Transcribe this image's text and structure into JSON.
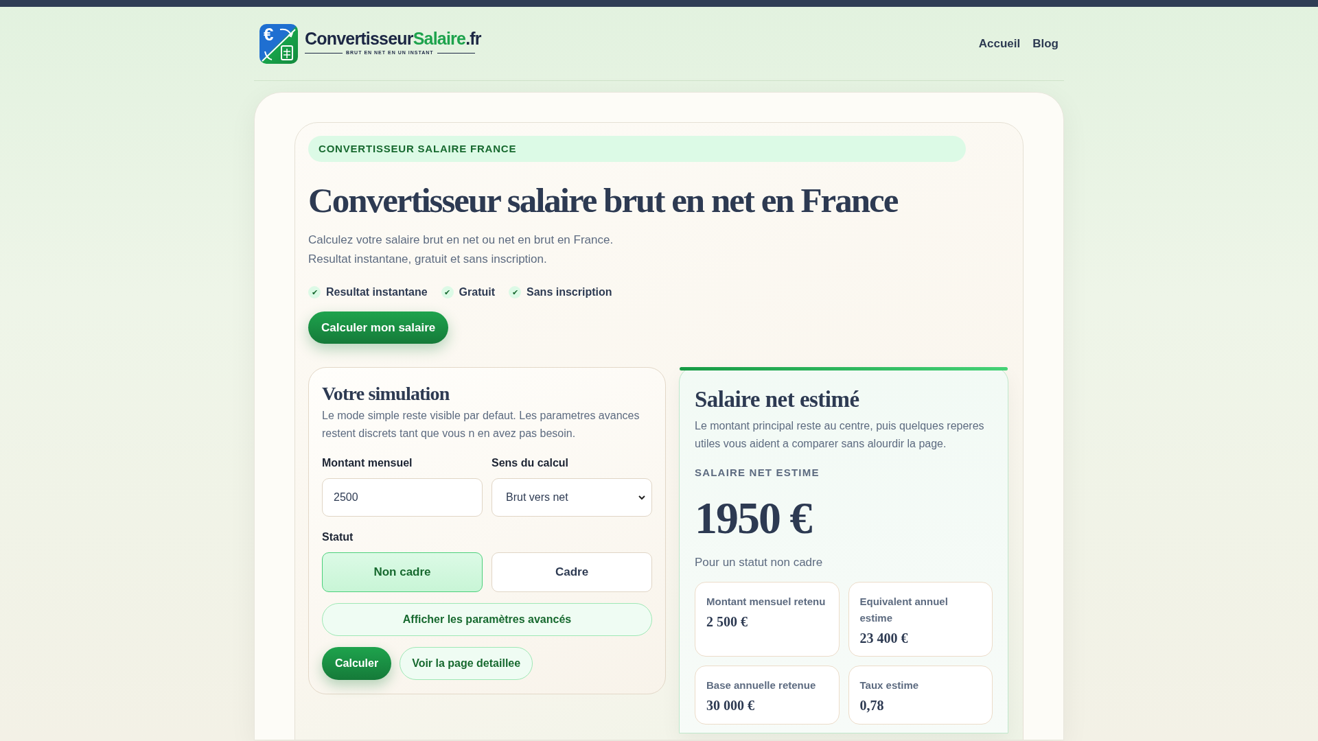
{
  "logo": {
    "icon_glyph": "€",
    "title_main": "Convertisseur",
    "title_accent": "Salaire",
    "title_suffix": ".fr",
    "tagline": "BRUT EN NET EN UN INSTANT"
  },
  "nav": [
    {
      "label": "Accueil"
    },
    {
      "label": "Blog"
    }
  ],
  "hero": {
    "badge": "CONVERTISSEUR SALAIRE FRANCE",
    "title": "Convertisseur salaire brut en net en France",
    "lines": [
      "Calculez votre salaire brut en net ou net en brut en France.",
      "Resultat instantane, gratuit et sans inscription."
    ],
    "features": [
      {
        "mark": "✔",
        "label": "Resultat instantane"
      },
      {
        "mark": "✔",
        "label": "Gratuit"
      },
      {
        "mark": "✔",
        "label": "Sans inscription"
      }
    ],
    "cta": "Calculer mon salaire"
  },
  "simulation": {
    "title": "Votre simulation",
    "description": "Le mode simple reste visible par defaut. Les parametres avances restent discrets tant que vous n en avez pas besoin.",
    "amount": {
      "label": "Montant mensuel",
      "value": "2500"
    },
    "direction": {
      "label": "Sens du calcul",
      "value": "Brut vers net"
    },
    "status_label": "Statut",
    "status_options": [
      {
        "label": "Non cadre",
        "selected": true
      },
      {
        "label": "Cadre",
        "selected": false
      }
    ],
    "advanced_button": "Afficher les paramètres avancés",
    "actions": [
      {
        "label": "Calculer",
        "kind": "primary"
      },
      {
        "label": "Voir la page detaillee",
        "kind": "secondary"
      }
    ]
  },
  "result": {
    "title": "Salaire net estimé",
    "description": "Le montant principal reste au centre, puis quelques reperes utiles vous aident a comparer sans alourdir la page.",
    "label": "SALAIRE NET ESTIME",
    "amount": "1950 €",
    "subtitle": "Pour un statut non cadre",
    "metrics": [
      {
        "label": "Montant mensuel retenu",
        "value": "2 500 €"
      },
      {
        "label": "Equivalent annuel estime",
        "value": "23 400 €"
      },
      {
        "label": "Base annuelle retenue",
        "value": "30 000 €"
      },
      {
        "label": "Taux estime",
        "value": "0,78"
      }
    ]
  }
}
